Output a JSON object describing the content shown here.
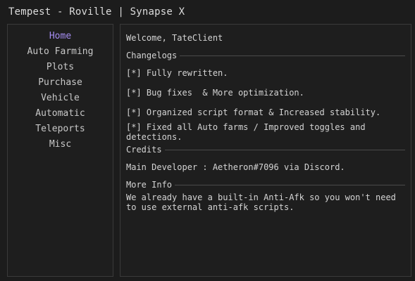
{
  "window": {
    "title": "Tempest - Roville | Synapse X"
  },
  "sidebar": {
    "items": [
      {
        "label": "Home",
        "active": true
      },
      {
        "label": "Auto Farming",
        "active": false
      },
      {
        "label": "Plots",
        "active": false
      },
      {
        "label": "Purchase",
        "active": false
      },
      {
        "label": "Vehicle",
        "active": false
      },
      {
        "label": "Automatic",
        "active": false
      },
      {
        "label": "Teleports",
        "active": false
      },
      {
        "label": "Misc",
        "active": false
      }
    ]
  },
  "home": {
    "welcome": "Welcome, TateClient",
    "changelogs": {
      "header": "Changelogs",
      "entries": [
        "[*] Fully rewritten.",
        "[*] Bug fixes  & More optimization.",
        "[*] Organized script format & Increased stability.",
        "[*] Fixed all Auto farms / Improved toggles and detections."
      ]
    },
    "credits": {
      "header": "Credits",
      "text": "Main Developer : Aetheron#7096 via Discord."
    },
    "more_info": {
      "header": "More Info",
      "text": "We already have a built-in Anti-Afk so you won't need to use external anti-afk scripts."
    }
  },
  "colors": {
    "background": "#1c1c1c",
    "panel_border": "#3a3a3a",
    "active_nav": "#a48cf0",
    "text": "#d4d4d4"
  }
}
